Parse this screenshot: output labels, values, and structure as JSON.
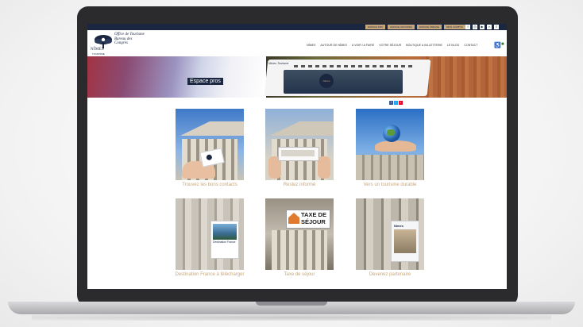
{
  "topbar": {
    "links": [
      "ESPACE PRO",
      "ESPACE GROUPES",
      "ESPACE PRESSE",
      "MON COMPTE"
    ],
    "icons": [
      "facebook-icon",
      "instagram-icon",
      "youtube-icon",
      "search-icon",
      "language-icon"
    ]
  },
  "logo": {
    "name": "NÎMES",
    "subtitle": "TOURISME",
    "script": "Office de Tourisme Bureau des Congrès"
  },
  "nav": {
    "items": [
      "NÎMES",
      "AUTOUR DE NÎMES",
      "A VOIR / A FAIRE",
      "VOTRE SÉJOUR",
      "BOUTIQUE & BILLETTERIE",
      "LE BLOG",
      "CONTACT"
    ]
  },
  "hero": {
    "badge": "Espace pros",
    "tablet_logo": "Nîmes Tourisme",
    "tablet_badge": "Nîmes"
  },
  "share": {
    "buttons": [
      "f",
      "t",
      "p"
    ],
    "colors": [
      "#3b5998",
      "#1da1f2",
      "#e60023"
    ]
  },
  "tiles": [
    {
      "caption": "Trouvez les bons contacts"
    },
    {
      "caption": "Restez informé"
    },
    {
      "caption": "Vers un tourisme durable"
    },
    {
      "caption": "Destination France à télécharger",
      "brochure_title": "Destination France"
    },
    {
      "caption": "Taxe de séjour",
      "sign_line1": "TAXE DE",
      "sign_line2": "SÉJOUR"
    },
    {
      "caption": "Devenez partenaire",
      "magazine_title": "Nîmes"
    }
  ],
  "colors": {
    "navy": "#1b2740",
    "gold": "#c7a77a",
    "frame": "#2b2b2d"
  }
}
